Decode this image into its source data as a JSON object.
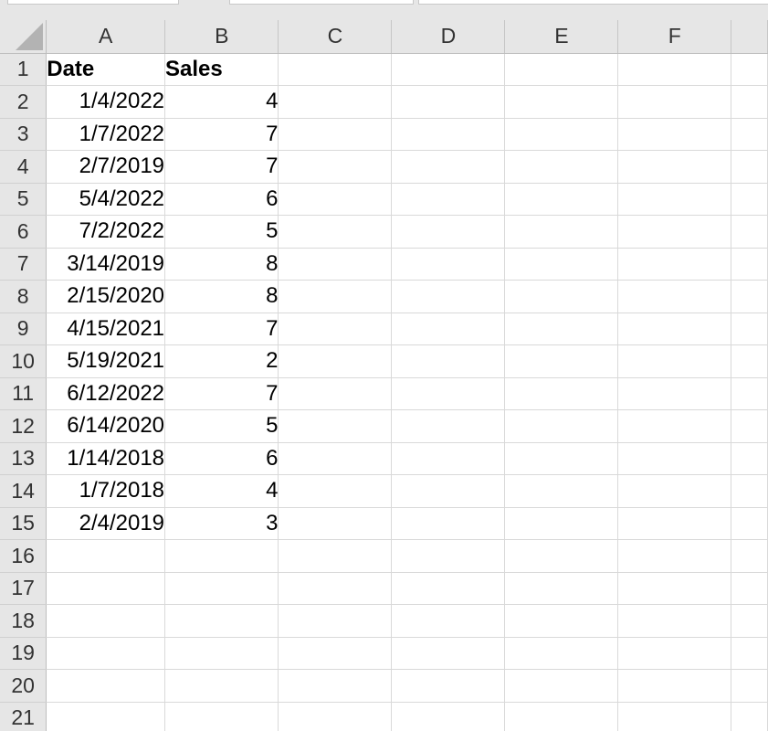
{
  "sheet": {
    "columns": [
      "A",
      "B",
      "C",
      "D",
      "E",
      "F"
    ],
    "header_row": {
      "number": "1",
      "date_label": "Date",
      "sales_label": "Sales"
    },
    "rows": [
      {
        "number": "2",
        "date": "1/4/2022",
        "sales": "4"
      },
      {
        "number": "3",
        "date": "1/7/2022",
        "sales": "7"
      },
      {
        "number": "4",
        "date": "2/7/2019",
        "sales": "7"
      },
      {
        "number": "5",
        "date": "5/4/2022",
        "sales": "6"
      },
      {
        "number": "6",
        "date": "7/2/2022",
        "sales": "5"
      },
      {
        "number": "7",
        "date": "3/14/2019",
        "sales": "8"
      },
      {
        "number": "8",
        "date": "2/15/2020",
        "sales": "8"
      },
      {
        "number": "9",
        "date": "4/15/2021",
        "sales": "7"
      },
      {
        "number": "10",
        "date": "5/19/2021",
        "sales": "2"
      },
      {
        "number": "11",
        "date": "6/12/2022",
        "sales": "7"
      },
      {
        "number": "12",
        "date": "6/14/2020",
        "sales": "5"
      },
      {
        "number": "13",
        "date": "1/14/2018",
        "sales": "6"
      },
      {
        "number": "14",
        "date": "1/7/2018",
        "sales": "4"
      },
      {
        "number": "15",
        "date": "2/4/2019",
        "sales": "3"
      }
    ],
    "empty_rows": [
      "16",
      "17",
      "18",
      "19",
      "20",
      "21"
    ]
  },
  "colors": {
    "header_bg": "#e6e6e6",
    "grid_line": "#d9d9d9",
    "header_text": "#333333",
    "corner_triangle": "#b3b3b3"
  }
}
